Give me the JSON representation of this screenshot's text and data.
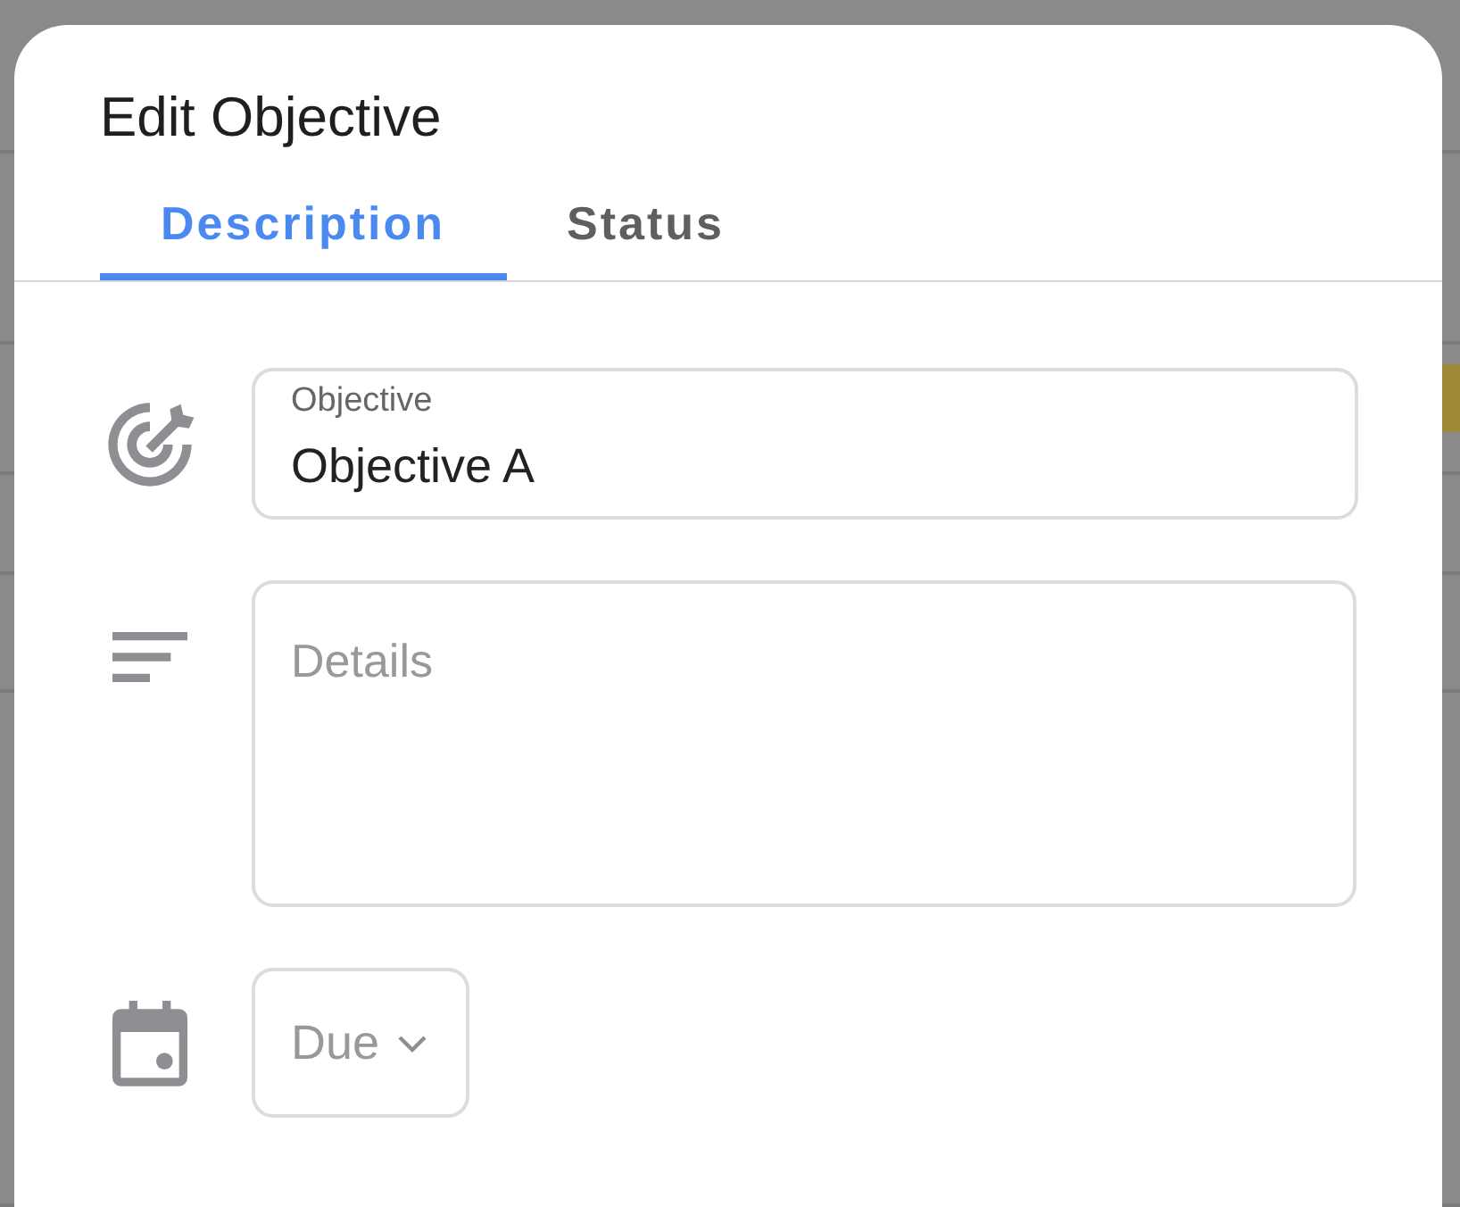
{
  "dialog": {
    "title": "Edit Objective",
    "tabs": [
      {
        "label": "Description",
        "selected": true
      },
      {
        "label": "Status",
        "selected": false
      }
    ],
    "fields": [
      {
        "kind": "text",
        "label": "Objective",
        "value": "Objective A"
      },
      {
        "kind": "textarea",
        "placeholder": "Details"
      },
      {
        "kind": "select",
        "placeholder": "Due"
      }
    ]
  }
}
